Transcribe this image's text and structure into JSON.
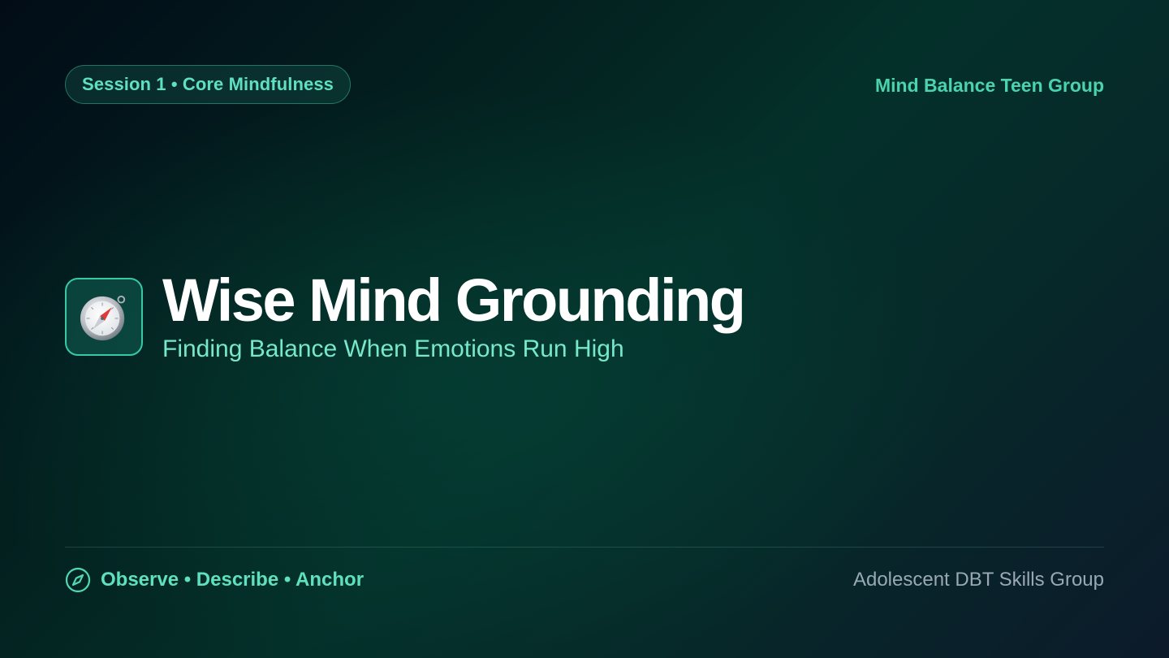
{
  "header": {
    "session_badge": "Session 1 • Core Mindfulness",
    "brand": "Mind Balance Teen Group"
  },
  "hero": {
    "icon": "compass-icon",
    "title": "Wise Mind Grounding",
    "subtitle": "Finding Balance When Emotions Run High"
  },
  "footer": {
    "icon": "compass-outline-icon",
    "tags": "Observe • Describe • Anchor",
    "group": "Adolescent DBT Skills Group"
  },
  "colors": {
    "accent": "#5fe0bf",
    "accent_border": "#37c9a6",
    "title": "#ffffff",
    "muted": "#98a8b4"
  }
}
